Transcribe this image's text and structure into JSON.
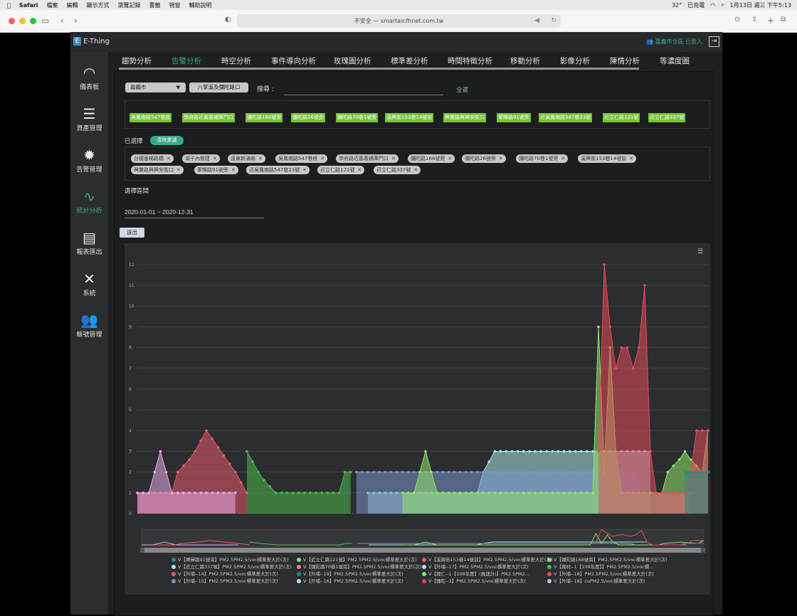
{
  "menubar": {
    "app": "Safari",
    "items": [
      "檔案",
      "編輯",
      "顯示方式",
      "瀏覽記錄",
      "書籤",
      "視窗",
      "輔助說明"
    ],
    "temp": "32°",
    "battery": "已充電",
    "clock": "1月13日 週三 下午5:13"
  },
  "browser": {
    "url": "不安全 — smartair.fhnet.com.tw"
  },
  "header": {
    "brand": "E-Thing",
    "user": "嘉義市全區 已登入"
  },
  "sidebar": [
    {
      "label": "儀表板",
      "icon": "dashboard-icon",
      "glyph": "◠"
    },
    {
      "label": "資產管理",
      "icon": "server-icon",
      "glyph": "☰"
    },
    {
      "label": "告警管理",
      "icon": "alert-gear-icon",
      "glyph": "✹"
    },
    {
      "label": "統計分析",
      "icon": "line-chart-icon",
      "glyph": "∿"
    },
    {
      "label": "報表匯出",
      "icon": "report-icon",
      "glyph": "▤"
    },
    {
      "label": "系統",
      "icon": "tools-icon",
      "glyph": "✕"
    },
    {
      "label": "帳號管理",
      "icon": "users-icon",
      "glyph": "👥"
    }
  ],
  "tabs": [
    "趨勢分析",
    "告警分析",
    "時空分析",
    "事件導向分析",
    "玫瑰圖分析",
    "標準差分析",
    "時間特徵分析",
    "移動分析",
    "影像分析",
    "陳情分析",
    "等濃度圖"
  ],
  "filters": {
    "city": "嘉義市",
    "area_button": "八掌溪及彌陀路口",
    "search_label": "搜尋 :",
    "search_value": "",
    "all_label": "全選"
  },
  "available_tags": [
    "吳鳳南路547巷底",
    "學府路近嘉義補庫門口",
    "彌陀路168號旁",
    "彌陀路26號旁",
    "彌陀路70巷1號旁",
    "溪興街153巷14號前",
    "興業路與興安街口",
    "軍輝路91號旁",
    "近吳鳳南路547巷23號",
    "近立仁路121號",
    "近立仁路337號"
  ],
  "selected_label": "已選擇",
  "clear_label": "清除重選",
  "selected_tags": [
    "台鐵垂楊路橋",
    "湖子內營建",
    "遠東新滿南",
    "吳鳳南路547巷底",
    "學府路近嘉義補庫門口",
    "彌陀路168號旁",
    "彌陀路26號旁",
    "彌陀路70巷1號旁",
    "溪興街153巷14號前",
    "興業路與興安街口",
    "軍輝路91號旁",
    "近吳鳳南路547巷23號",
    "近立仁路121號",
    "近立仁路337號"
  ],
  "range_label": "選擇區間",
  "date_range": "2020-01-01 ~ 2020-12-31",
  "submit_label": "送出",
  "legend": [
    {
      "name": "V【軍輝路91號旁】PM2.5PM2.5/voc標準差大於(次)",
      "color": "#2a8a86"
    },
    {
      "name": "V【近立仁路121號】PM2.5PM2.5/voc標準差大於(次)",
      "color": "#8fe36b"
    },
    {
      "name": "V【溪興街153巷14號前】PM2.5PM2.5/voc標準差大於(次)",
      "color": "#f05a6a"
    },
    {
      "name": "V【彌陀路168號旁】PM2.5PM2.5/voc標準差大於(次)",
      "color": "#8fe36b"
    },
    {
      "name": "V【近立仁路337號】PM2.5PM2.5/voc標準差大於(次)",
      "color": "#a8e8e8"
    },
    {
      "name": "V【彌陀路70巷1號旁】PM2.5PM2.5/voc標準差大於(次)",
      "color": "#f078a0"
    },
    {
      "name": "V【外埔--17】PM2.5PM2.5/voc標準差大於(次)",
      "color": "#a8e8e8"
    },
    {
      "name": "V【興村--1【108年度】】PM2.5PM2.5/voc標...",
      "color": "#4fb84f"
    },
    {
      "name": "V【外埔--14】PM2.5PM2.5/voc標準差大於(次)",
      "color": "#e65a6a"
    },
    {
      "name": "V【外埔--19】PM2.5PM2.5/voc標準差大於(次)",
      "color": "#2a8a86"
    },
    {
      "name": "V【興仁--1【108年度】(風速計)】PM2.5PM2...",
      "color": "#8fe36b"
    },
    {
      "name": "V【外埔--18】PM2.5PM2.5/voc標準差大於(次)",
      "color": "#e64a5a"
    },
    {
      "name": "V【外埔--15】PM2.5PM2.5/voc標準差大於(次)",
      "color": "#7d92c8"
    },
    {
      "name": "V【外埔--16】PM2.5PM2.5/voc標準差大於(次)",
      "color": "#a8e8e8"
    },
    {
      "name": "V【彌陀--3】PM2.5PM2.5/voc標準差大於(次)",
      "color": "#e63a5a"
    },
    {
      "name": "V【外埔--18】coPM2.5/voc標準差大於(次)",
      "color": "#e8a8e8"
    }
  ],
  "chart_data": {
    "type": "area",
    "ylim": [
      0,
      12
    ],
    "yticks": [
      0,
      1,
      2,
      3,
      4,
      5,
      6,
      7,
      8,
      9,
      10,
      11,
      12
    ],
    "x_count": 100,
    "series": [
      {
        "color": "#a8e8e8",
        "values": [
          null,
          null,
          null,
          null,
          null,
          null,
          null,
          null,
          null,
          null,
          null,
          null,
          null,
          null,
          null,
          null,
          null,
          null,
          null,
          null,
          null,
          null,
          null,
          null,
          null,
          null,
          null,
          null,
          null,
          null,
          null,
          null,
          null,
          null,
          null,
          null,
          null,
          null,
          null,
          null,
          1,
          1,
          1,
          1,
          1,
          1,
          1,
          1,
          1,
          1,
          1,
          1,
          1,
          1,
          1,
          1,
          1,
          1,
          1,
          1,
          2,
          2.5,
          3,
          3,
          3,
          3,
          3,
          3,
          3,
          3,
          3,
          3,
          3,
          3,
          3,
          3,
          3,
          3,
          3,
          3,
          3,
          3,
          3,
          3,
          3,
          3,
          3,
          3,
          3,
          3,
          null,
          null,
          null,
          null,
          null,
          null,
          null,
          null,
          null,
          null
        ]
      },
      {
        "color": "#7d92c8",
        "values": [
          null,
          null,
          null,
          null,
          null,
          null,
          null,
          null,
          null,
          null,
          null,
          null,
          null,
          null,
          null,
          null,
          null,
          null,
          null,
          null,
          null,
          null,
          null,
          null,
          null,
          null,
          null,
          null,
          null,
          null,
          null,
          null,
          null,
          null,
          null,
          null,
          null,
          null,
          2,
          2,
          2,
          2,
          2,
          2,
          2,
          2,
          2,
          2,
          2,
          2,
          2,
          2,
          2,
          2,
          2,
          2,
          2,
          2,
          2,
          2,
          2,
          2,
          2,
          2,
          2,
          2,
          2,
          2,
          2,
          2,
          2,
          2,
          2,
          2,
          2,
          2,
          2,
          2,
          2,
          2,
          2,
          2,
          2,
          2,
          2,
          2,
          2,
          1,
          1,
          1,
          1,
          1,
          1,
          1,
          1,
          1,
          1,
          null,
          null,
          null
        ]
      },
      {
        "color": "#e65a6a",
        "values": [
          1,
          1,
          1,
          1,
          1,
          1,
          1,
          2,
          2.3,
          2.6,
          3,
          3.5,
          4,
          3.6,
          3.2,
          2.8,
          2.4,
          2,
          1.5,
          1,
          null,
          null,
          null,
          null,
          null,
          null,
          null,
          null,
          null,
          null,
          null,
          null,
          null,
          null,
          null,
          null,
          null,
          null,
          null,
          null,
          null,
          null,
          null,
          null,
          null,
          null,
          null,
          null,
          null,
          null,
          null,
          null,
          null,
          null,
          null,
          null,
          null,
          null,
          null,
          null,
          null,
          null,
          null,
          null,
          null,
          null,
          null,
          null,
          null,
          null,
          null,
          null,
          null,
          null,
          null,
          null,
          null,
          null,
          null,
          null,
          null,
          null,
          null,
          null,
          null,
          null,
          null,
          null,
          null,
          null,
          null,
          null,
          null,
          null,
          null,
          null,
          null,
          null,
          null,
          null
        ]
      },
      {
        "color": "#e8a8e8",
        "values": [
          1,
          1,
          1,
          2,
          3,
          2,
          1,
          1,
          1,
          1,
          1,
          1,
          1,
          1,
          1,
          1,
          1,
          1,
          null,
          null,
          null,
          null,
          null,
          null,
          null,
          null,
          null,
          null,
          null,
          null,
          null,
          null,
          null,
          null,
          null,
          null,
          null,
          null,
          null,
          null,
          null,
          null,
          null,
          null,
          null,
          null,
          null,
          null,
          null,
          null,
          null,
          null,
          null,
          null,
          null,
          null,
          null,
          null,
          null,
          null,
          null,
          null,
          null,
          null,
          null,
          null,
          null,
          null,
          null,
          null,
          null,
          null,
          null,
          null,
          null,
          null,
          null,
          null,
          null,
          null,
          null,
          null,
          null,
          null,
          null,
          null,
          null,
          null,
          null,
          null,
          null,
          null,
          null,
          null,
          null,
          null,
          null,
          null,
          null,
          null
        ]
      },
      {
        "color": "#4fb84f",
        "values": [
          null,
          null,
          null,
          null,
          null,
          null,
          null,
          null,
          null,
          null,
          null,
          null,
          null,
          null,
          null,
          null,
          null,
          null,
          null,
          3,
          2.5,
          2,
          1.6,
          1.3,
          1,
          1,
          1,
          1,
          1,
          1,
          1,
          1,
          1,
          1,
          1,
          1,
          2,
          2,
          null,
          null,
          null,
          null,
          null,
          null,
          null,
          null,
          null,
          null,
          null,
          null,
          null,
          null,
          null,
          null,
          null,
          null,
          null,
          null,
          null,
          null,
          null,
          null,
          null,
          null,
          null,
          null,
          null,
          null,
          null,
          null,
          null,
          null,
          null,
          null,
          null,
          null,
          null,
          null,
          null,
          null,
          null,
          null,
          null,
          null,
          null,
          null,
          null,
          null,
          null,
          null,
          null,
          null,
          null,
          null,
          null,
          null,
          null,
          null,
          null,
          null
        ]
      },
      {
        "color": "#8fe36b",
        "values": [
          null,
          null,
          null,
          null,
          null,
          null,
          null,
          null,
          null,
          null,
          null,
          null,
          null,
          null,
          null,
          null,
          null,
          null,
          null,
          null,
          null,
          null,
          null,
          null,
          null,
          null,
          null,
          null,
          null,
          null,
          null,
          null,
          null,
          null,
          null,
          null,
          null,
          null,
          null,
          null,
          null,
          null,
          null,
          null,
          null,
          null,
          1,
          1,
          1,
          2,
          3,
          2,
          1,
          1,
          1,
          1,
          1,
          1,
          1,
          1,
          1,
          1,
          1,
          1,
          1,
          1,
          1,
          1,
          1,
          1,
          1,
          1,
          1,
          1,
          1,
          1,
          1,
          1,
          1,
          1,
          9,
          2,
          8,
          3,
          1,
          1,
          1,
          1,
          1,
          1,
          1,
          1,
          2,
          2.3,
          2.6,
          3,
          2.6,
          2.3,
          2,
          4
        ]
      },
      {
        "color": "#e64a5a",
        "values": [
          null,
          null,
          null,
          null,
          null,
          null,
          null,
          null,
          null,
          null,
          null,
          null,
          null,
          null,
          null,
          null,
          null,
          null,
          null,
          null,
          null,
          null,
          null,
          null,
          null,
          null,
          null,
          null,
          null,
          null,
          null,
          null,
          null,
          null,
          null,
          null,
          null,
          null,
          null,
          null,
          null,
          null,
          null,
          null,
          null,
          null,
          null,
          null,
          null,
          null,
          null,
          null,
          null,
          null,
          null,
          null,
          null,
          null,
          null,
          null,
          null,
          null,
          null,
          null,
          null,
          null,
          null,
          null,
          null,
          null,
          null,
          null,
          null,
          null,
          null,
          null,
          null,
          null,
          null,
          null,
          3,
          12,
          9,
          7,
          8,
          8,
          7,
          8,
          11,
          3,
          1,
          1,
          1,
          1,
          1,
          1,
          2,
          4,
          4,
          4
        ]
      },
      {
        "color": "#2a8a86",
        "values": [
          null,
          null,
          null,
          null,
          null,
          null,
          null,
          null,
          null,
          null,
          null,
          null,
          null,
          null,
          null,
          null,
          null,
          null,
          null,
          null,
          null,
          null,
          null,
          null,
          null,
          null,
          null,
          null,
          null,
          null,
          null,
          null,
          null,
          null,
          null,
          null,
          null,
          null,
          null,
          null,
          null,
          null,
          null,
          null,
          null,
          null,
          null,
          null,
          null,
          null,
          null,
          null,
          null,
          null,
          null,
          null,
          null,
          null,
          null,
          null,
          null,
          null,
          null,
          null,
          null,
          null,
          null,
          null,
          null,
          null,
          null,
          null,
          null,
          null,
          null,
          null,
          null,
          null,
          null,
          null,
          null,
          null,
          null,
          null,
          null,
          null,
          null,
          null,
          null,
          null,
          null,
          null,
          null,
          null,
          null,
          2,
          2,
          2,
          2,
          2
        ]
      }
    ]
  }
}
